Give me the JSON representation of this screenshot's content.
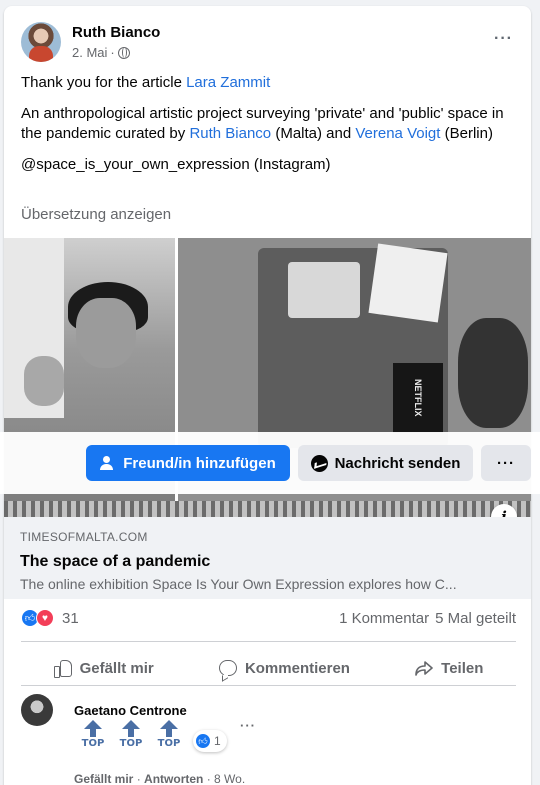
{
  "post": {
    "author": "Ruth Bianco",
    "date": "2. Mai",
    "separator": "·",
    "line1_text": "Thank you for the article ",
    "line1_link": "Lara Zammit",
    "line2_text_a": "An anthropological artistic project surveying 'private' and 'public' space in the pandemic curated by ",
    "line2_link_a": "Ruth Bianco",
    "line2_text_b": " (Malta) and ",
    "line2_link_b": "Verena Voigt",
    "line2_text_c": " (Berlin)",
    "line3_text": "@space_is_your_own_expression (Instagram)",
    "translate_label": "Übersetzung anzeigen",
    "more_label": "···",
    "photo_right_box_text": "NETFLIX"
  },
  "action_bar": {
    "add_friend_label": "Freund/in hinzufügen",
    "message_label": "Nachricht senden",
    "more_label": "···"
  },
  "link_preview": {
    "info_label": "i",
    "domain": "TIMESOFMALTA.COM",
    "title": "The space of a pandemic",
    "description": "The online exhibition Space Is Your Own Expression explores how C..."
  },
  "stats": {
    "reaction_count": "31",
    "comments": "1 Kommentar",
    "shares": "5 Mal geteilt"
  },
  "actions": {
    "like": "Gefällt mir",
    "comment": "Kommentieren",
    "share": "Teilen"
  },
  "comment": {
    "author": "Gaetano Centrone",
    "top_label": "TOP",
    "reaction_count": "1",
    "more_label": "···",
    "like_action": "Gefällt mir",
    "reply_action": "Antworten",
    "separator": " · ",
    "age": "8 Wo."
  },
  "colors": {
    "accent": "#1877f2",
    "link": "#216fdb",
    "love": "#f33e58",
    "muted_text": "#65676b"
  }
}
